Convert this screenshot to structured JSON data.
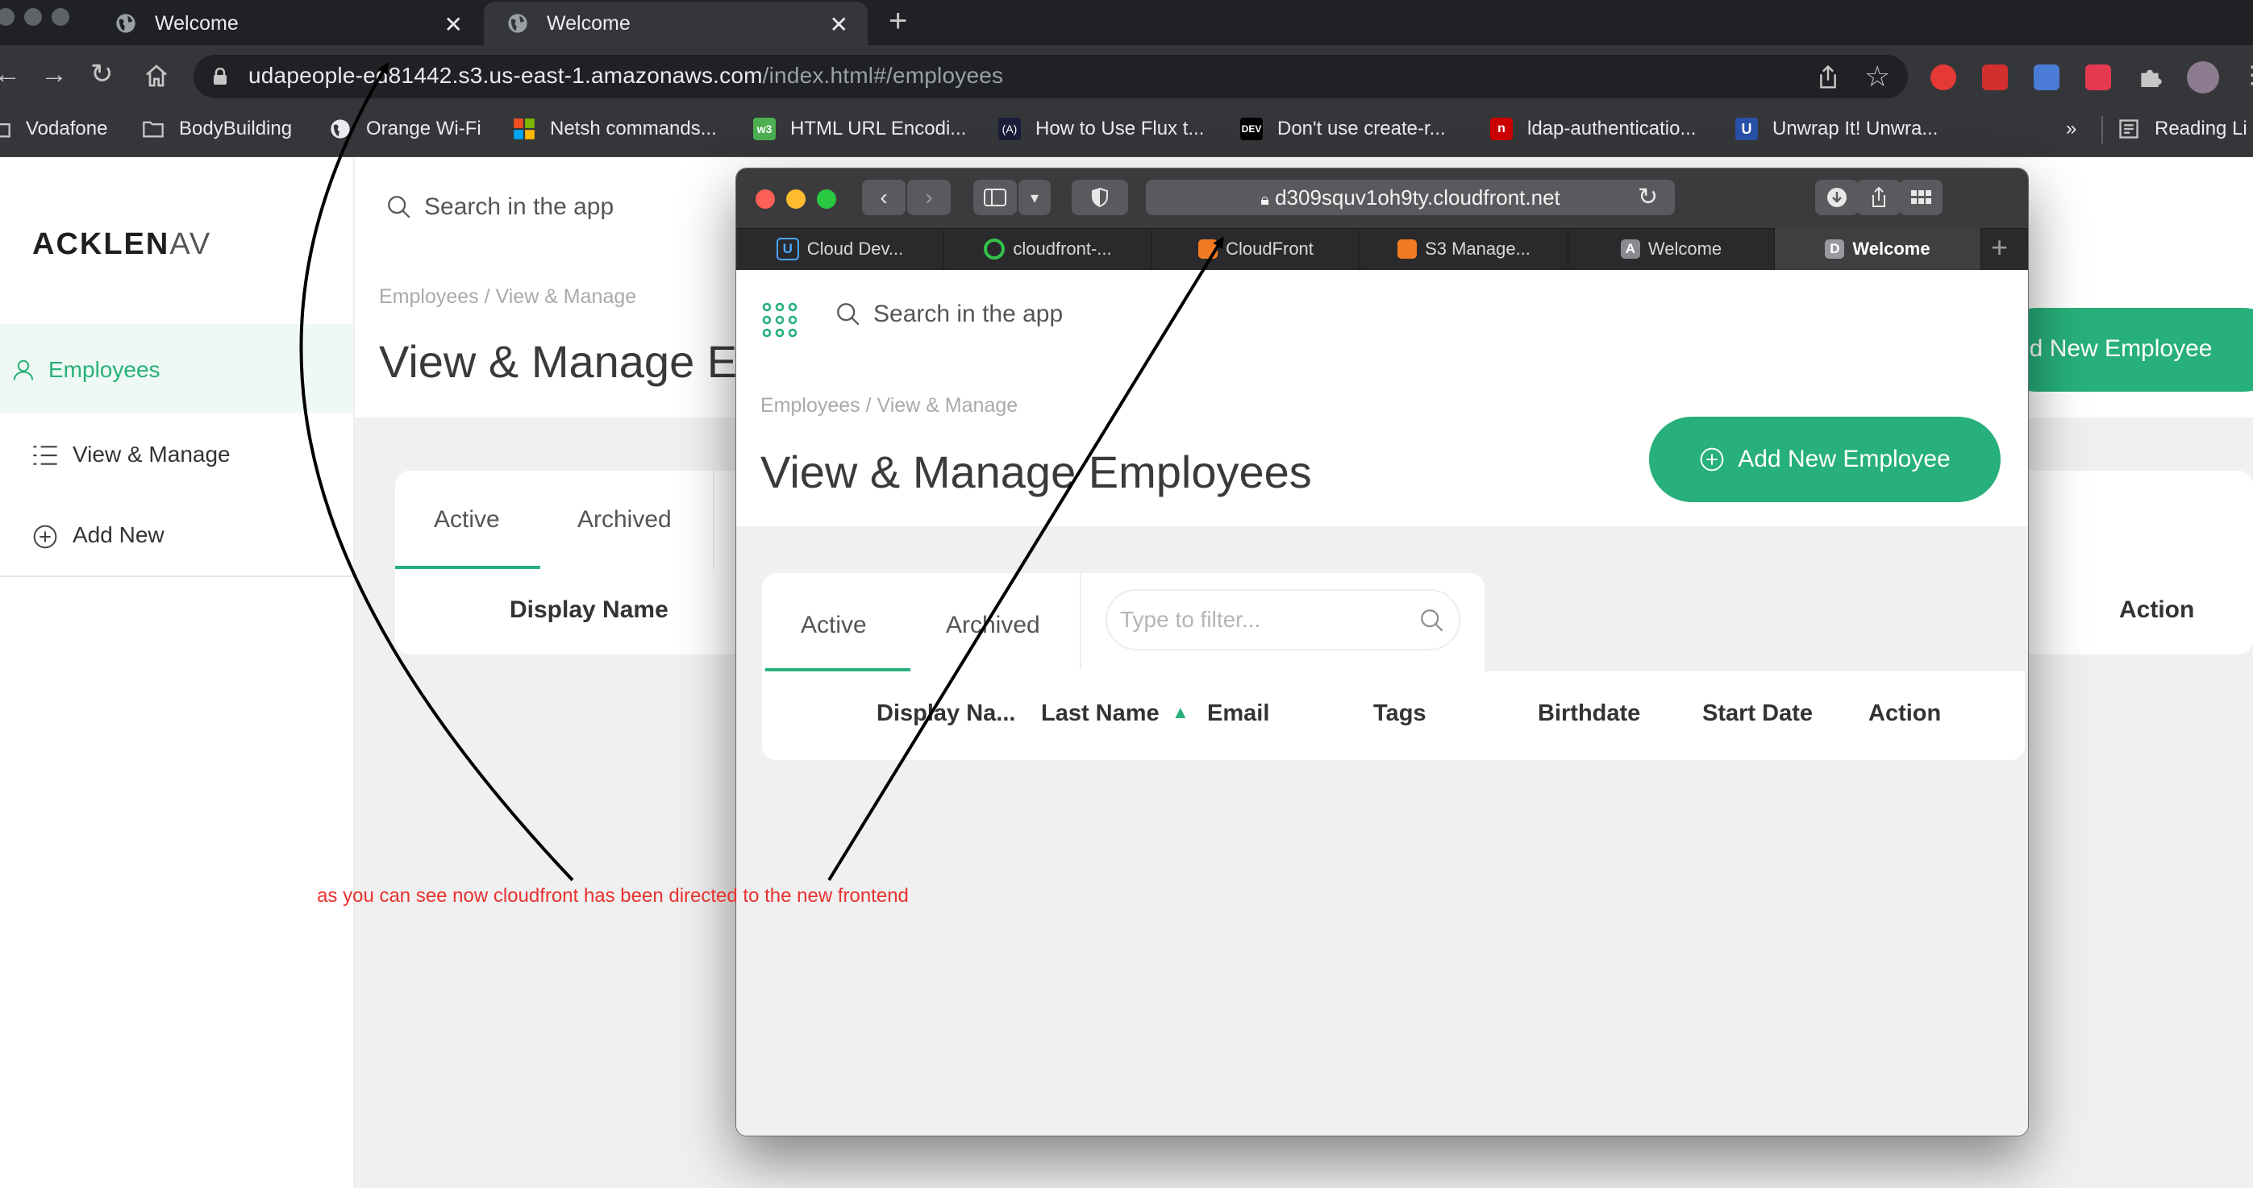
{
  "chrome": {
    "tabs": [
      {
        "title": "Welcome"
      },
      {
        "title": "Welcome"
      }
    ],
    "url": {
      "host": "udapeople-ed81442.s3.us-east-1.amazonaws.com",
      "path": "/index.html#/employees"
    },
    "bookmarks": [
      {
        "label": "Vodafone",
        "icon": "folder-icon"
      },
      {
        "label": "BodyBuilding",
        "icon": "folder-icon"
      },
      {
        "label": "Orange Wi-Fi",
        "icon": "globe-icon"
      },
      {
        "label": "Netsh commands...",
        "icon": "microsoft-icon"
      },
      {
        "label": "HTML URL Encodi...",
        "icon": "w3-icon"
      },
      {
        "label": "How to Use Flux t...",
        "icon": "code-icon"
      },
      {
        "label": "Don't use create-r...",
        "icon": "dev-icon"
      },
      {
        "label": "ldap-authenticatio...",
        "icon": "npm-icon"
      },
      {
        "label": "Unwrap It! Unwra...",
        "icon": "u-icon"
      },
      {
        "label": "Reading Li",
        "icon": "reading-list-icon"
      }
    ],
    "overflow_label": "»"
  },
  "background_app": {
    "logo_bold": "ACKLEN",
    "logo_thin": "AV",
    "search_placeholder": "Search in the app",
    "nav": [
      {
        "label": "Employees",
        "icon": "user-icon"
      },
      {
        "label": "View & Manage",
        "icon": "list-icon"
      },
      {
        "label": "Add New",
        "icon": "plus-circle-icon"
      }
    ],
    "breadcrumb": "Employees   /   View & Manage",
    "title": "View & Manage E",
    "tabs": [
      "Active",
      "Archived"
    ],
    "columns": {
      "display_name": "Display Name",
      "action": "Action"
    },
    "add_button": "dd New Employee"
  },
  "safari": {
    "address": "d309squv1oh9ty.cloudfront.net",
    "tabs": [
      {
        "label": "Cloud Dev...",
        "icon": "udacity-icon"
      },
      {
        "label": "cloudfront-...",
        "icon": "circleci-icon"
      },
      {
        "label": "CloudFront",
        "icon": "aws-icon"
      },
      {
        "label": "S3 Manage...",
        "icon": "aws-icon"
      },
      {
        "label": "Welcome",
        "icon": "letter-a-icon",
        "letter": "A"
      },
      {
        "label": "Welcome",
        "icon": "letter-d-icon",
        "letter": "D",
        "active": true
      }
    ],
    "app": {
      "search_placeholder": "Search in the app",
      "breadcrumb": "Employees   /   View & Manage",
      "title": "View & Manage Employees",
      "add_button": "Add New Employee",
      "tabs": [
        "Active",
        "Archived"
      ],
      "filter_placeholder": "Type to filter...",
      "columns": [
        "Display Na...",
        "Last Name",
        "Email",
        "Tags",
        "Birthdate",
        "Start Date",
        "Action"
      ],
      "sort_indicator": "▲"
    }
  },
  "annotation": {
    "text": "as you can see now cloudfront has been directed to the new frontend"
  },
  "colors": {
    "accent": "#27b07b",
    "annotation": "#e8322f",
    "chrome_dark": "#202124",
    "safari_dark": "#3b3b3d"
  }
}
